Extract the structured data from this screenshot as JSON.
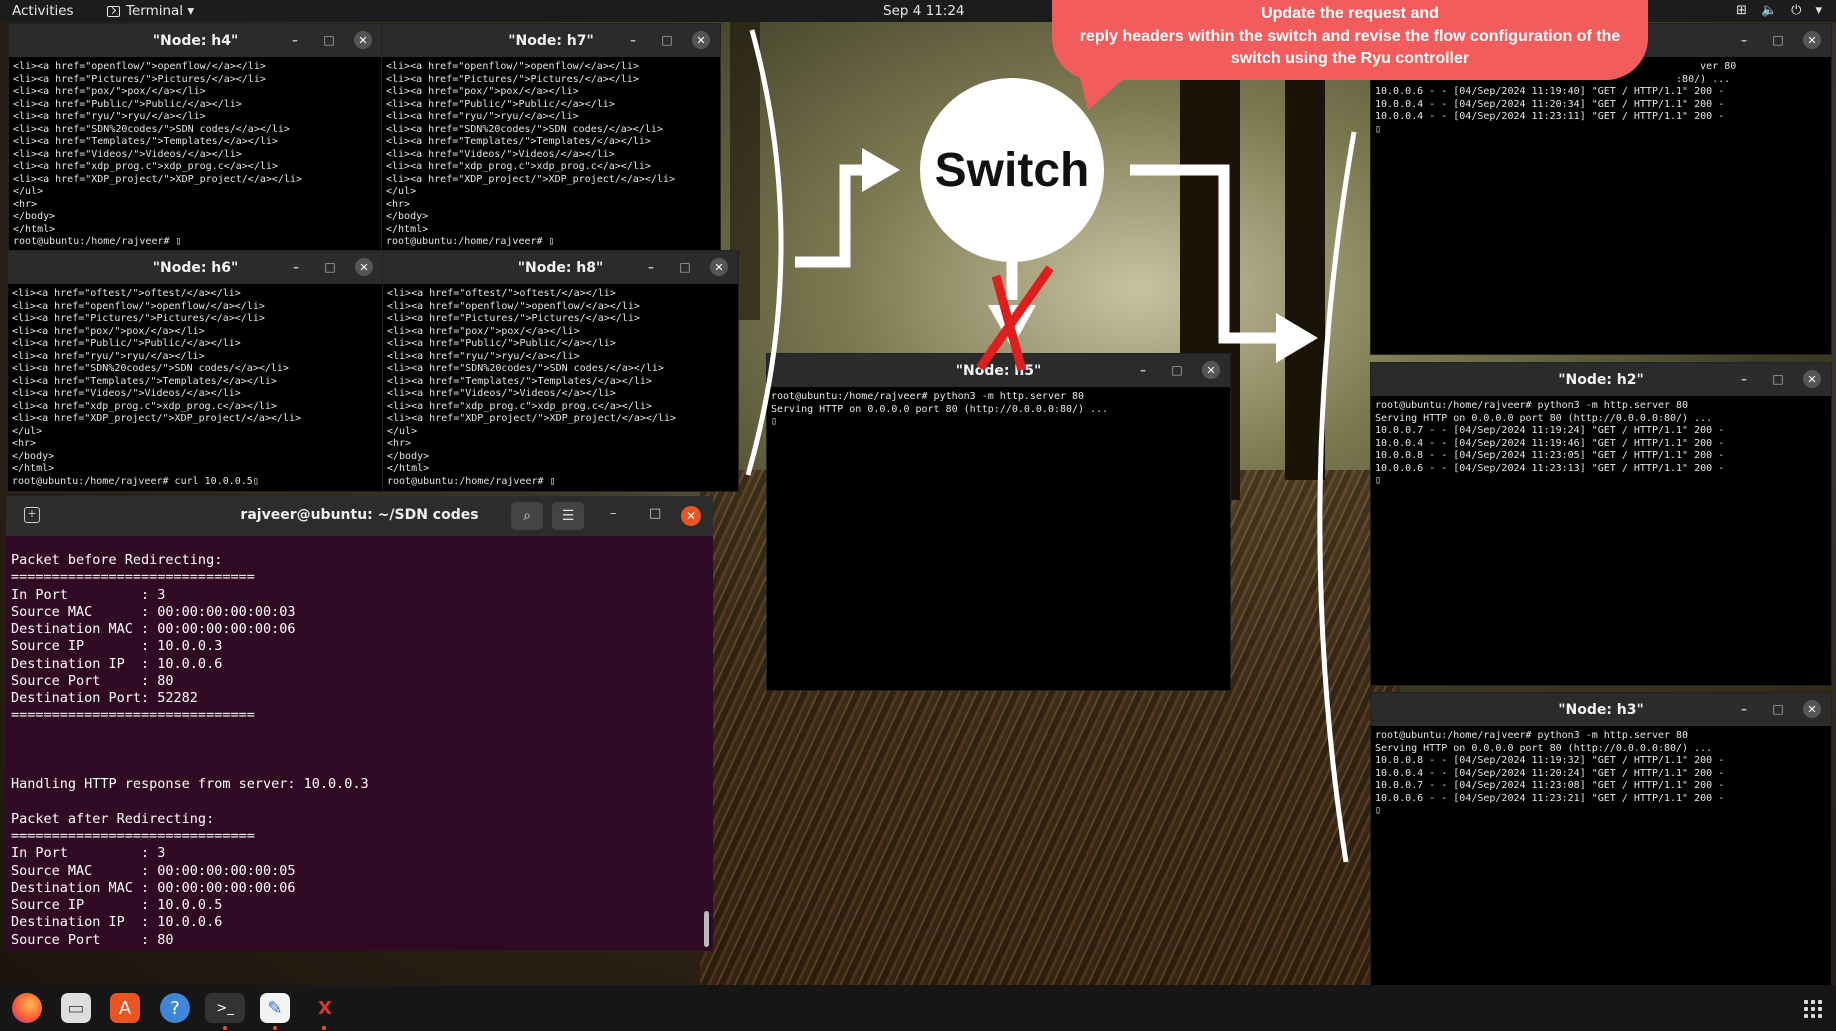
{
  "topbar": {
    "activities": "Activities",
    "app_menu": "Terminal ▾",
    "clock": "Sep 4  11:24",
    "tray": [
      "network-icon",
      "volume-icon",
      "power-icon"
    ]
  },
  "callout": {
    "lines": [
      "Update the request and",
      "reply headers within the switch and revise the flow configuration of the",
      "switch using the Ryu controller"
    ]
  },
  "switch": {
    "label": "Switch"
  },
  "windows": {
    "h4": {
      "title": "\"Node: h4\"",
      "content": "<li><a href=\"openflow/\">openflow/</a></li>\n<li><a href=\"Pictures/\">Pictures/</a></li>\n<li><a href=\"pox/\">pox/</a></li>\n<li><a href=\"Public/\">Public/</a></li>\n<li><a href=\"ryu/\">ryu/</a></li>\n<li><a href=\"SDN%20codes/\">SDN codes/</a></li>\n<li><a href=\"Templates/\">Templates/</a></li>\n<li><a href=\"Videos/\">Videos/</a></li>\n<li><a href=\"xdp_prog.c\">xdp_prog.c</a></li>\n<li><a href=\"XDP_project/\">XDP_project/</a></li>\n</ul>\n<hr>\n</body>\n</html>\nroot@ubuntu:/home/rajveer# ▯"
    },
    "h7": {
      "title": "\"Node: h7\"",
      "content": "<li><a href=\"openflow/\">openflow/</a></li>\n<li><a href=\"Pictures/\">Pictures/</a></li>\n<li><a href=\"pox/\">pox/</a></li>\n<li><a href=\"Public/\">Public/</a></li>\n<li><a href=\"ryu/\">ryu/</a></li>\n<li><a href=\"SDN%20codes/\">SDN codes/</a></li>\n<li><a href=\"Templates/\">Templates/</a></li>\n<li><a href=\"Videos/\">Videos/</a></li>\n<li><a href=\"xdp_prog.c\">xdp_prog.c</a></li>\n<li><a href=\"XDP_project/\">XDP_project/</a></li>\n</ul>\n<hr>\n</body>\n</html>\nroot@ubuntu:/home/rajveer# ▯"
    },
    "h6": {
      "title": "\"Node: h6\"",
      "content": "<li><a href=\"oftest/\">oftest/</a></li>\n<li><a href=\"openflow/\">openflow/</a></li>\n<li><a href=\"Pictures/\">Pictures/</a></li>\n<li><a href=\"pox/\">pox/</a></li>\n<li><a href=\"Public/\">Public/</a></li>\n<li><a href=\"ryu/\">ryu/</a></li>\n<li><a href=\"SDN%20codes/\">SDN codes/</a></li>\n<li><a href=\"Templates/\">Templates/</a></li>\n<li><a href=\"Videos/\">Videos/</a></li>\n<li><a href=\"xdp_prog.c\">xdp_prog.c</a></li>\n<li><a href=\"XDP_project/\">XDP_project/</a></li>\n</ul>\n<hr>\n</body>\n</html>\nroot@ubuntu:/home/rajveer# curl 10.0.0.5▯"
    },
    "h8": {
      "title": "\"Node: h8\"",
      "content": "<li><a href=\"oftest/\">oftest/</a></li>\n<li><a href=\"openflow/\">openflow/</a></li>\n<li><a href=\"Pictures/\">Pictures/</a></li>\n<li><a href=\"pox/\">pox/</a></li>\n<li><a href=\"Public/\">Public/</a></li>\n<li><a href=\"ryu/\">ryu/</a></li>\n<li><a href=\"SDN%20codes/\">SDN codes/</a></li>\n<li><a href=\"Templates/\">Templates/</a></li>\n<li><a href=\"Videos/\">Videos/</a></li>\n<li><a href=\"xdp_prog.c\">xdp_prog.c</a></li>\n<li><a href=\"XDP_project/\">XDP_project/</a></li>\n</ul>\n<hr>\n</body>\n</html>\nroot@ubuntu:/home/rajveer# ▯"
    },
    "h5": {
      "title": "\"Node: h5\"",
      "content": "root@ubuntu:/home/rajveer# python3 -m http.server 80\nServing HTTP on 0.0.0.0 port 80 (http://0.0.0.0:80/) ...\n▯"
    },
    "h1": {
      "title": "",
      "content": "                                                      ver 80\n                                                  :80/) ...\n10.0.0.6 - - [04/Sep/2024 11:19:40] \"GET / HTTP/1.1\" 200 -\n10.0.0.4 - - [04/Sep/2024 11:20:34] \"GET / HTTP/1.1\" 200 -\n10.0.0.4 - - [04/Sep/2024 11:23:11] \"GET / HTTP/1.1\" 200 -\n▯"
    },
    "h2": {
      "title": "\"Node: h2\"",
      "content": "root@ubuntu:/home/rajveer# python3 -m http.server 80\nServing HTTP on 0.0.0.0 port 80 (http://0.0.0.0:80/) ...\n10.0.0.7 - - [04/Sep/2024 11:19:24] \"GET / HTTP/1.1\" 200 -\n10.0.0.4 - - [04/Sep/2024 11:19:46] \"GET / HTTP/1.1\" 200 -\n10.0.0.8 - - [04/Sep/2024 11:23:05] \"GET / HTTP/1.1\" 200 -\n10.0.0.6 - - [04/Sep/2024 11:23:13] \"GET / HTTP/1.1\" 200 -\n▯"
    },
    "h3": {
      "title": "\"Node: h3\"",
      "content": "root@ubuntu:/home/rajveer# python3 -m http.server 80\nServing HTTP on 0.0.0.0 port 80 (http://0.0.0.0:80/) ...\n10.0.0.8 - - [04/Sep/2024 11:19:32] \"GET / HTTP/1.1\" 200 -\n10.0.0.4 - - [04/Sep/2024 11:20:24] \"GET / HTTP/1.1\" 200 -\n10.0.0.7 - - [04/Sep/2024 11:23:08] \"GET / HTTP/1.1\" 200 -\n10.0.0.6 - - [04/Sep/2024 11:23:21] \"GET / HTTP/1.1\" 200 -\n▯"
    }
  },
  "main_terminal": {
    "title": "rajveer@ubuntu: ~/SDN codes",
    "content": "Packet before Redirecting:\n==============================\nIn Port         : 3\nSource MAC      : 00:00:00:00:00:03\nDestination MAC : 00:00:00:00:00:06\nSource IP       : 10.0.0.3\nDestination IP  : 10.0.0.6\nSource Port     : 80\nDestination Port: 52282\n==============================\n\n\n\nHandling HTTP response from server: 10.0.0.3\n\nPacket after Redirecting:\n==============================\nIn Port         : 3\nSource MAC      : 00:00:00:00:00:05\nDestination MAC : 00:00:00:00:00:06\nSource IP       : 10.0.0.5\nDestination IP  : 10.0.0.6\nSource Port     : 80"
  },
  "window_controls": {
    "minimize": "–",
    "maximize": "□",
    "close": "✕"
  },
  "dock_icons": [
    "firefox-icon",
    "files-icon",
    "app-center-icon",
    "help-icon",
    "terminal-icon",
    "text-editor-icon",
    "xterm-icon"
  ],
  "colors": {
    "callout": "#f25c5c",
    "terminal_bg": "#300a24",
    "close_button": "#e95420",
    "cross_mark": "#e01e1e"
  }
}
